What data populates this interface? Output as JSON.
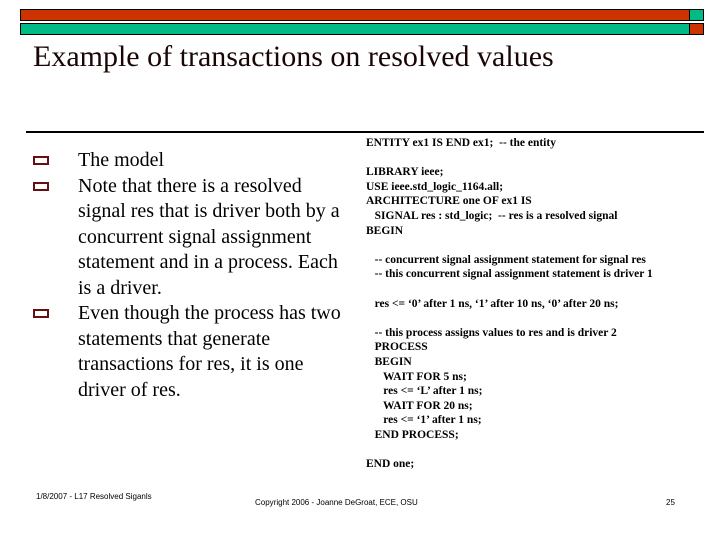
{
  "slide": {
    "title": "Example of transactions on resolved values",
    "theme": {
      "bar_primary": "#cc3300",
      "bar_secondary": "#00bb85",
      "bullet_color": "#661111",
      "title_color": "#1a0505"
    }
  },
  "header_bars": [
    {
      "name": "top-bar",
      "wide_color": "#cc3300",
      "narrow_color": "#00bb85"
    },
    {
      "name": "bottom-bar",
      "wide_color": "#00bb85",
      "narrow_color": "#cc3300"
    }
  ],
  "bullets": [
    {
      "marker": "hollow-square",
      "text": "The model"
    },
    {
      "marker": "hollow-square",
      "text": "Note that there is a resolved signal res that is driver both by a concurrent signal assignment statement and in a process.  Each is a driver."
    },
    {
      "marker": "hollow-square",
      "text": "Even though the process has two statements that generate transactions for res, it is one driver of res."
    }
  ],
  "code": {
    "language": "VHDL",
    "lines": [
      "ENTITY ex1 IS END ex1;  -- the entity",
      "",
      "LIBRARY ieee;",
      "USE ieee.std_logic_1164.all;",
      "ARCHITECTURE one OF ex1 IS",
      "   SIGNAL res : std_logic;  -- res is a resolved signal",
      "BEGIN",
      "",
      "   -- concurrent signal assignment statement for signal res",
      "   -- this concurrent signal assignment statement is driver 1",
      "",
      "   res <= ‘0’ after 1 ns, ‘1’ after 10 ns, ‘0’ after 20 ns;",
      "",
      "   -- this process assigns values to res and is driver 2",
      "   PROCESS",
      "   BEGIN",
      "      WAIT FOR 5 ns;",
      "      res <= ‘L’ after 1 ns;",
      "      WAIT FOR 20 ns;",
      "      res <= ‘1’ after 1 ns;",
      "   END PROCESS;",
      "",
      "END one;"
    ]
  },
  "footer": {
    "left": "1/8/2007 - L17 Resolved Siganls",
    "center": "Copyright 2006 - Joanne DeGroat, ECE, OSU",
    "page_number": "25"
  }
}
